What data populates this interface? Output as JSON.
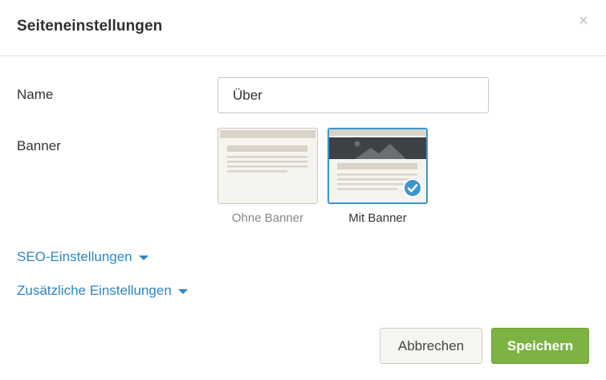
{
  "dialog": {
    "title": "Seiteneinstellungen",
    "close_symbol": "×"
  },
  "form": {
    "name_label": "Name",
    "name_value": "Über",
    "banner_label": "Banner",
    "banner_options": [
      {
        "label": "Ohne Banner",
        "selected": false
      },
      {
        "label": "Mit Banner",
        "selected": true
      }
    ]
  },
  "sections": {
    "seo_label": "SEO-Einstellungen",
    "additional_label": "Zusätzliche Einstellungen"
  },
  "footer": {
    "cancel_label": "Abbrechen",
    "save_label": "Speichern"
  },
  "colors": {
    "accent_blue": "#3c95cf",
    "link_blue": "#2f86c1",
    "save_green": "#7cb342"
  }
}
